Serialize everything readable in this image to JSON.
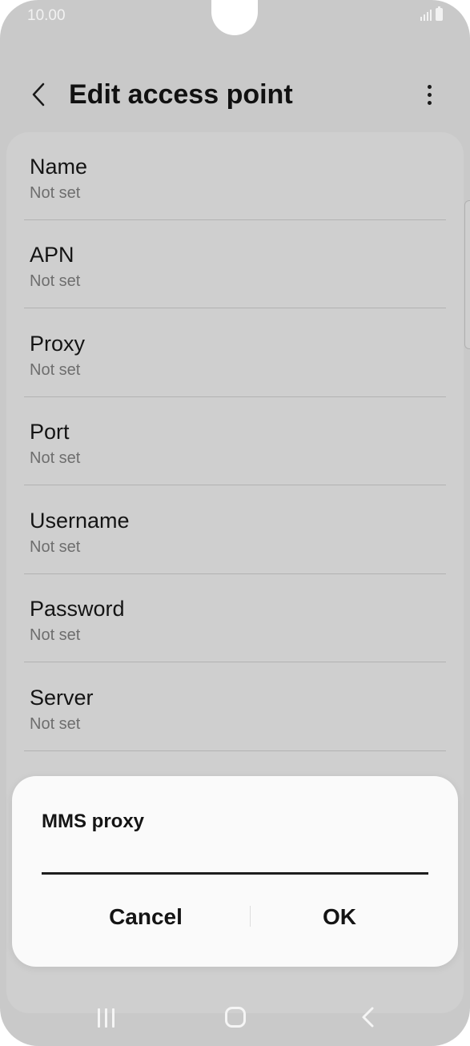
{
  "status_bar": {
    "time": "10.00"
  },
  "header": {
    "title": "Edit access point"
  },
  "settings": [
    {
      "label": "Name",
      "value": "Not set"
    },
    {
      "label": "APN",
      "value": "Not set"
    },
    {
      "label": "Proxy",
      "value": "Not set"
    },
    {
      "label": "Port",
      "value": "Not set"
    },
    {
      "label": "Username",
      "value": "Not set"
    },
    {
      "label": "Password",
      "value": "Not set"
    },
    {
      "label": "Server",
      "value": "Not set"
    }
  ],
  "dialog": {
    "title": "MMS proxy",
    "input_value": "",
    "cancel_label": "Cancel",
    "ok_label": "OK"
  },
  "colors": {
    "dimmed_background": "#c9c9c9",
    "dialog_background": "#fafafa",
    "text": "#141414",
    "secondary_text": "#6e6e6e"
  },
  "icons": {
    "back": "chevron-left-icon",
    "more": "more-vertical-icon",
    "signal": "signal-icon",
    "battery": "battery-icon",
    "nav_recent": "recent-apps-icon",
    "nav_home": "home-icon",
    "nav_back": "back-icon"
  }
}
